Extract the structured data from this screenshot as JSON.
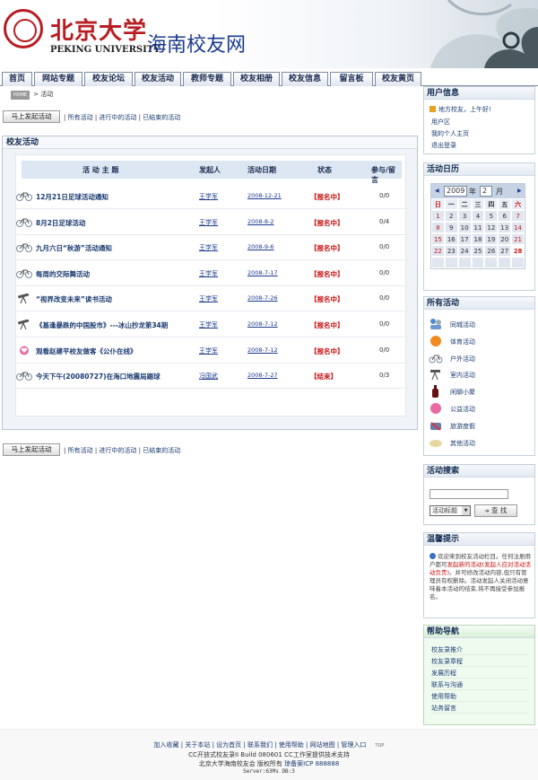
{
  "header": {
    "logo_cn": "北京大学",
    "logo_en": "PEKING UNIVERSITY",
    "site_title": "海南校友网"
  },
  "nav": [
    "首页",
    "网站专题",
    "校友论坛",
    "校友活动",
    "教师专题",
    "校友相册",
    "校友信息",
    "留言板",
    "校友黄页"
  ],
  "breadcrumb": {
    "home": "HOME",
    "sep": ">",
    "current": "活动"
  },
  "actions": {
    "launch": "马上发起活动",
    "filters": [
      "所有活动",
      "进行中的活动",
      "已结束的活动"
    ]
  },
  "panel": {
    "title": "校友活动",
    "columns": [
      "活 动 主 题",
      "发起人",
      "活动日期",
      "状态",
      "参与/留言"
    ],
    "rows": [
      {
        "title": "12月21日足球活动通知",
        "user": "王学军",
        "date": "2008-12-21",
        "status": "【报名中】",
        "count": "0/0",
        "icon": "bike-icon"
      },
      {
        "title": "8月2日足球活动",
        "user": "王学军",
        "date": "2008-8-2",
        "status": "【报名中】",
        "count": "0/4",
        "icon": "bike-icon"
      },
      {
        "title": "九月六日“秋游”活动通知",
        "user": "王学军",
        "date": "2008-9-6",
        "status": "【报名中】",
        "count": "0/0",
        "icon": "bike-icon"
      },
      {
        "title": "每周的交际舞活动",
        "user": "王学军",
        "date": "2008-7-17",
        "status": "【报名中】",
        "count": "0/0",
        "icon": "bike-icon"
      },
      {
        "title": "“视界改变未来”读书活动",
        "user": "王学军",
        "date": "2008-7-26",
        "status": "【报名中】",
        "count": "0/0",
        "icon": "telescope-icon"
      },
      {
        "title": "《基逢暴跌的中国股市》---冰山抄龙第34期",
        "user": "王学军",
        "date": "2008-7-12",
        "status": "【报名中】",
        "count": "0/0",
        "icon": "telescope-icon"
      },
      {
        "title": "观看赵建平校友做客《公仆在线》",
        "user": "王学军",
        "date": "2008-7-12",
        "status": "【报名中】",
        "count": "0/0",
        "icon": "heart-icon"
      },
      {
        "title": "今天下午(20080727)在海口地震局踢球",
        "user": "冯国武",
        "date": "2008-7-27",
        "status": "【结束】",
        "count": "0/3",
        "icon": "bike-icon"
      }
    ]
  },
  "sidebar": {
    "user_info": {
      "title": "用户信息",
      "greeting": "地方校友，上午好!",
      "links": [
        "用户区",
        "我的个人主页",
        "退出登录"
      ]
    },
    "calendar": {
      "title": "活动日历",
      "year": "2009",
      "year_label": "年",
      "month": "2",
      "month_label": "月",
      "weekdays": [
        "日",
        "一",
        "二",
        "三",
        "四",
        "五",
        "六"
      ],
      "days": [
        [
          "1",
          "2",
          "3",
          "4",
          "5",
          "6",
          "7"
        ],
        [
          "8",
          "9",
          "10",
          "11",
          "12",
          "13",
          "14"
        ],
        [
          "15",
          "16",
          "17",
          "18",
          "19",
          "20",
          "21"
        ],
        [
          "22",
          "23",
          "24",
          "25",
          "26",
          "27",
          "28"
        ]
      ]
    },
    "all_activities": {
      "title": "所有活动",
      "items": [
        "同城活动",
        "体育活动",
        "户外活动",
        "室内活动",
        "闲聊小聚",
        "公益活动",
        "旅游度假",
        "其他活动"
      ]
    },
    "search": {
      "title": "活动搜索",
      "select": "活动标题",
      "button": "查 找"
    },
    "tips": {
      "title": "温馨提示",
      "text_before": "欢迎来到校友活动栏目。任何注册用户都可",
      "text_red": "发起新的活动(发起人应对活动活动负责)",
      "text_after": "。并可修改活动内容,但只有管理员有权删除。活动发起人关闭活动意味着本活动的结束,将不再接受参加报名。"
    },
    "help": {
      "title": "帮助导航",
      "items": [
        "校友录推介",
        "校友录章程",
        "发展历程",
        "联系与沟通",
        "使用帮助",
        "站务留言"
      ]
    }
  },
  "footer": {
    "links": [
      "加入收藏",
      "关于本站",
      "设为首页",
      "联系我们",
      "使用帮助",
      "网站地图",
      "管理入口"
    ],
    "top": "TOP",
    "line2": "CC开放式校友录II Build 080601 CC工作室提供技术支持",
    "line3a": "北京大学海南校友会 版权所有",
    "line3b": "琼备案ICP 888888",
    "line4": "Server:63Ms  DB:3"
  }
}
